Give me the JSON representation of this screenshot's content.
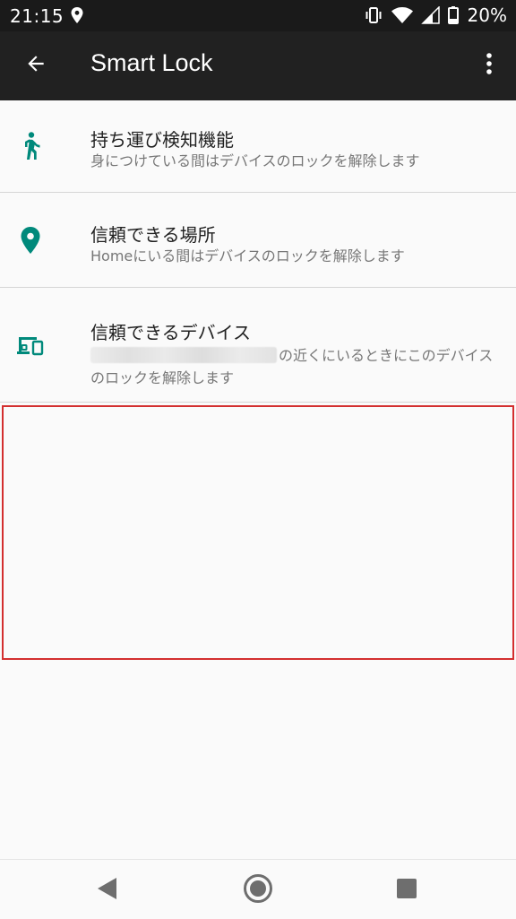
{
  "status_bar": {
    "time": "21:15",
    "battery_percent": "20%",
    "icons": [
      "location-icon",
      "vibrate-icon",
      "wifi-icon",
      "signal-icon",
      "battery-icon"
    ]
  },
  "app_bar": {
    "title": "Smart Lock",
    "back_icon": "arrow-back-icon",
    "overflow_icon": "more-vert-icon"
  },
  "items": [
    {
      "icon": "walking-person-icon",
      "title": "持ち運び検知機能",
      "subtitle": "身につけている間はデバイスのロックを解除します"
    },
    {
      "icon": "location-pin-icon",
      "title": "信頼できる場所",
      "subtitle": "Homeにいる間はデバイスのロックを解除します"
    },
    {
      "icon": "devices-icon",
      "title": "信頼できるデバイス",
      "subtitle_suffix": "の近くにいるときにこのデバイスのロックを解除します"
    }
  ],
  "colors": {
    "accent": "#00897b",
    "app_bar": "#212121",
    "status_bar": "#1a1a1a",
    "highlight": "#d32f2f"
  },
  "nav_bar": {
    "icons": [
      "nav-back-icon",
      "nav-home-icon",
      "nav-recents-icon"
    ]
  }
}
